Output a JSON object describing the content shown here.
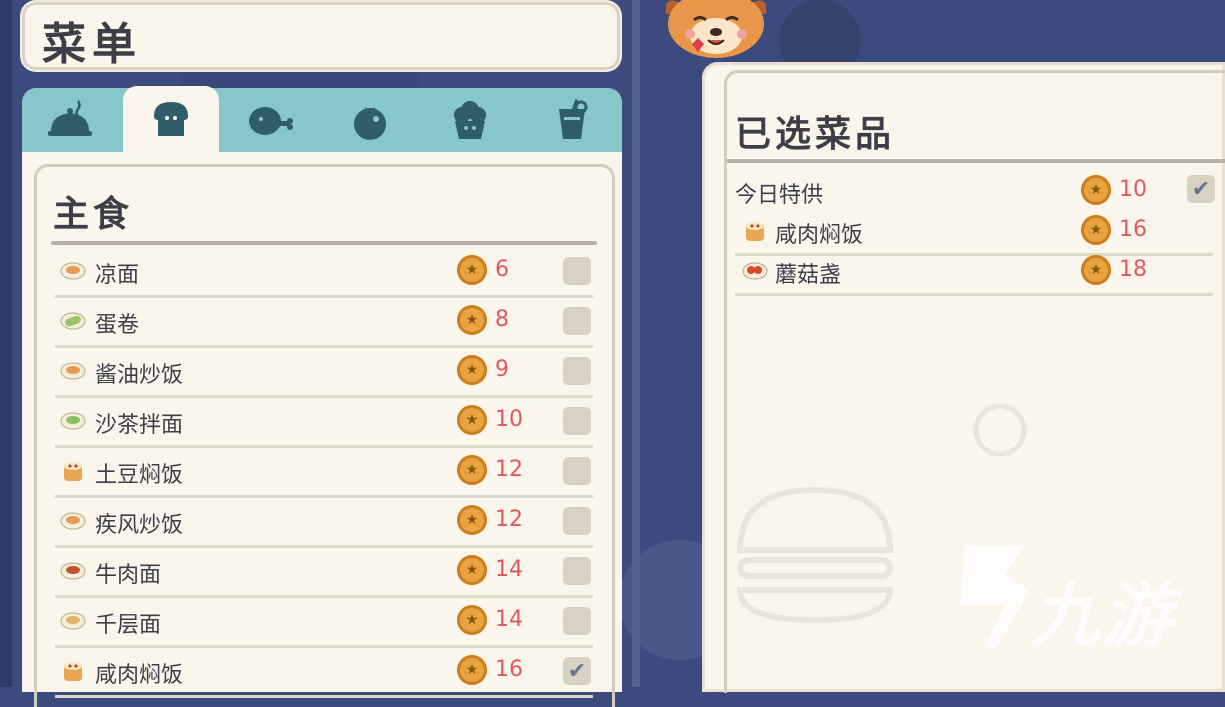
{
  "menu": {
    "title": "菜单",
    "tabs": [
      {
        "icon": "cloche-icon",
        "active": false
      },
      {
        "icon": "bread-icon",
        "active": true
      },
      {
        "icon": "drumstick-icon",
        "active": false
      },
      {
        "icon": "tomato-icon",
        "active": false
      },
      {
        "icon": "muffin-icon",
        "active": false
      },
      {
        "icon": "drink-icon",
        "active": false
      }
    ],
    "section_title": "主食",
    "items": [
      {
        "name": "凉面",
        "price": "6",
        "checked": false,
        "icon": "noodle-plate-icon"
      },
      {
        "name": "蛋卷",
        "price": "8",
        "checked": false,
        "icon": "egg-roll-icon"
      },
      {
        "name": "酱油炒饭",
        "price": "9",
        "checked": false,
        "icon": "fried-rice-icon"
      },
      {
        "name": "沙茶拌面",
        "price": "10",
        "checked": false,
        "icon": "satay-noodle-icon"
      },
      {
        "name": "土豆焖饭",
        "price": "12",
        "checked": false,
        "icon": "rice-pot-icon"
      },
      {
        "name": "疾风炒饭",
        "price": "12",
        "checked": false,
        "icon": "fried-rice-icon"
      },
      {
        "name": "牛肉面",
        "price": "14",
        "checked": false,
        "icon": "beef-noodle-icon"
      },
      {
        "name": "千层面",
        "price": "14",
        "checked": false,
        "icon": "lasagna-icon"
      },
      {
        "name": "咸肉焖饭",
        "price": "16",
        "checked": true,
        "icon": "rice-pot-icon"
      }
    ]
  },
  "selected": {
    "title": "已选菜品",
    "special": {
      "name": "今日特供",
      "price": "10",
      "checked": true
    },
    "items": [
      {
        "name": "咸肉焖饭",
        "price": "16",
        "icon": "rice-pot-icon"
      },
      {
        "name": "蘑菇盏",
        "price": "18",
        "icon": "mushroom-dish-icon"
      }
    ]
  },
  "currency_icon": "coin-star-icon",
  "watermark": "九游",
  "colors": {
    "price": "#e0585e",
    "tab_bar": "#87c7c9",
    "panel": "#fbf6ec",
    "background": "#3d4a7e"
  }
}
